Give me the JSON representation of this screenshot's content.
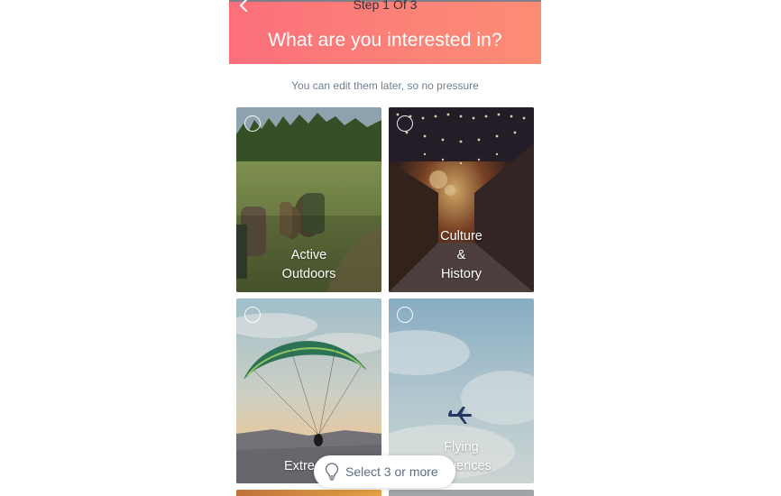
{
  "header": {
    "step": "Step 1 Of 3",
    "title": "What are you interested in?"
  },
  "subtitle": "You can edit them later, so no pressure",
  "tiles": [
    {
      "lines": [
        "Active",
        "Outdoors"
      ],
      "selected": false
    },
    {
      "lines": [
        "Culture",
        "&",
        "History"
      ],
      "selected": false
    },
    {
      "lines": [
        "Extre"
      ],
      "selected": false
    },
    {
      "lines": [
        "Flying",
        "riences"
      ],
      "selected": false
    }
  ],
  "cta": {
    "label": "Select 3 or more",
    "icon": "lightbulb-icon"
  },
  "colors": {
    "header_start": "#fb6f7a",
    "header_end": "#fd8c74",
    "subtitle": "#6f7f8f",
    "cta_text": "#5d6d7d"
  }
}
